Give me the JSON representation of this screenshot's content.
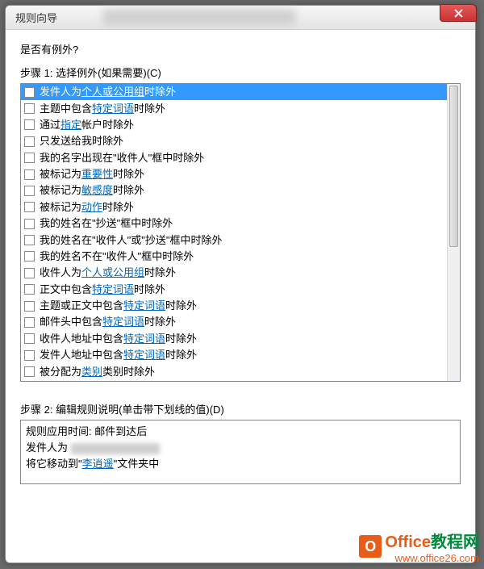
{
  "window": {
    "title": "规则向导"
  },
  "question": "是否有例外?",
  "step1_label": "步骤 1: 选择例外(如果需要)(C)",
  "items": [
    {
      "pre": "发件人为 ",
      "link": "个人或公用组",
      "post": " 时除外",
      "selected": true
    },
    {
      "pre": "主题中包含 ",
      "link": "特定词语",
      "post": " 时除外"
    },
    {
      "pre": "通过 ",
      "link": "指定",
      "post": " 帐户时除外"
    },
    {
      "pre": "只发送给我时除外",
      "link": "",
      "post": ""
    },
    {
      "pre": "我的名字出现在\"收件人\"框中时除外",
      "link": "",
      "post": ""
    },
    {
      "pre": "被标记为 ",
      "link": "重要性",
      "post": " 时除外"
    },
    {
      "pre": "被标记为 ",
      "link": "敏感度",
      "post": " 时除外"
    },
    {
      "pre": "被标记为 ",
      "link": "动作",
      "post": " 时除外"
    },
    {
      "pre": "我的姓名在\"抄送\"框中时除外",
      "link": "",
      "post": ""
    },
    {
      "pre": "我的姓名在\"收件人\"或\"抄送\"框中时除外",
      "link": "",
      "post": ""
    },
    {
      "pre": "我的姓名不在\"收件人\"框中时除外",
      "link": "",
      "post": ""
    },
    {
      "pre": "收件人为 ",
      "link": "个人或公用组",
      "post": " 时除外"
    },
    {
      "pre": "正文中包含 ",
      "link": "特定词语",
      "post": " 时除外"
    },
    {
      "pre": "主题或正文中包含 ",
      "link": "特定词语",
      "post": " 时除外"
    },
    {
      "pre": "邮件头中包含 ",
      "link": "特定词语",
      "post": " 时除外"
    },
    {
      "pre": "收件人地址中包含 ",
      "link": "特定词语",
      "post": " 时除外"
    },
    {
      "pre": "发件人地址中包含 ",
      "link": "特定词语",
      "post": " 时除外"
    },
    {
      "pre": "被分配为 ",
      "link": "类别",
      "post": " 类别时除外"
    }
  ],
  "step2_label": "步骤 2: 编辑规则说明(单击带下划线的值)(D)",
  "desc": {
    "line1": "规则应用时间: 邮件到达后",
    "line2_pre": "发件人为 ",
    "line3_pre": "将它移动到\"",
    "line3_link": "李逍遥",
    "line3_post": "\"文件夹中"
  },
  "watermark": {
    "brand1": "Office",
    "brand2": "教程网",
    "url": "www.office26.com"
  }
}
